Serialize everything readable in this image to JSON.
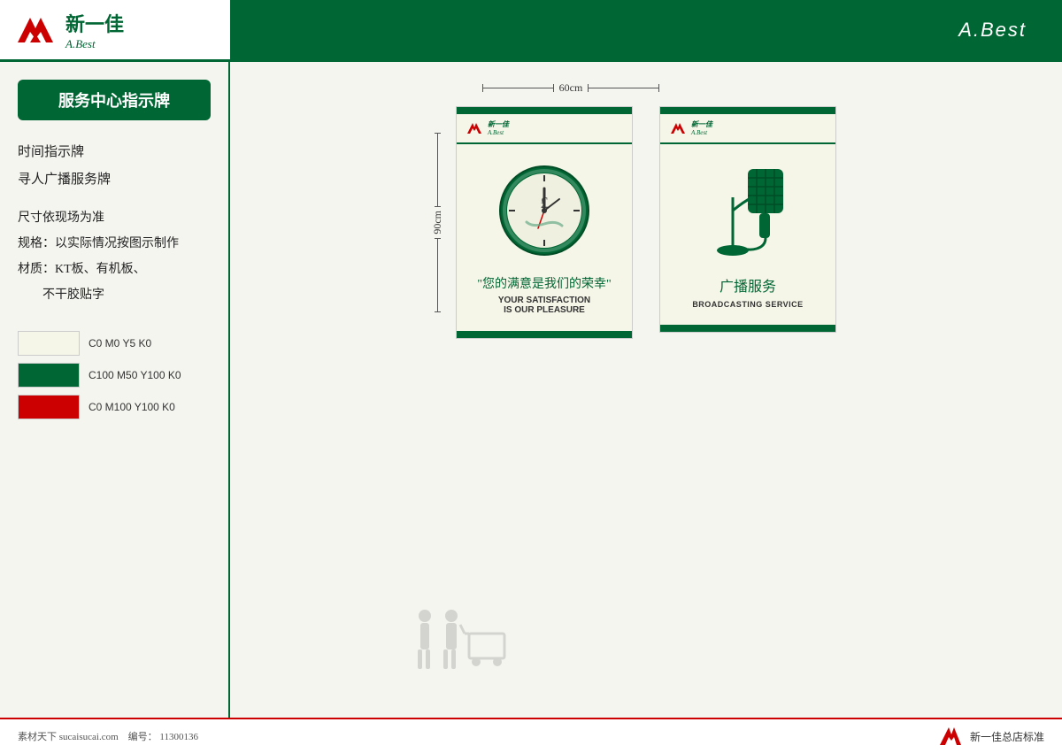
{
  "header": {
    "logo_cn": "新一佳",
    "logo_en": "A.Best",
    "title": "A.Best"
  },
  "sidebar": {
    "box_title": "服务中心指示牌",
    "items": [
      "时间指示牌",
      "寻人广播服务牌"
    ],
    "specs": [
      "尺寸依现场为准",
      "规格：以实际情况按图示制作",
      "材质：KT板、有机板、",
      "不干胶贴字"
    ],
    "swatches": [
      {
        "color": "#f5f5e8",
        "label": "C0  M0  Y5  K0"
      },
      {
        "color": "#006633",
        "label": "C100 M50 Y100 K0"
      },
      {
        "color": "#cc0000",
        "label": "C0 M100 Y100 K0"
      }
    ]
  },
  "sign1": {
    "width_dim": "60cm",
    "height_dim": "90cm",
    "cn_text": "您的满意是我们的荣幸",
    "quote_open": "“",
    "quote_close": "”",
    "en_line1": "YOUR SATISFACTION",
    "en_line2": "IS OUR PLEASURE"
  },
  "sign2": {
    "cn_text": "广播服务",
    "en_text": "BROADCASTING SERVICE"
  },
  "bottom": {
    "source": "素材天下 sucaisucai.com",
    "code_label": "编号：",
    "code": "11300136",
    "brand_suffix": "新一佳总店标准"
  }
}
